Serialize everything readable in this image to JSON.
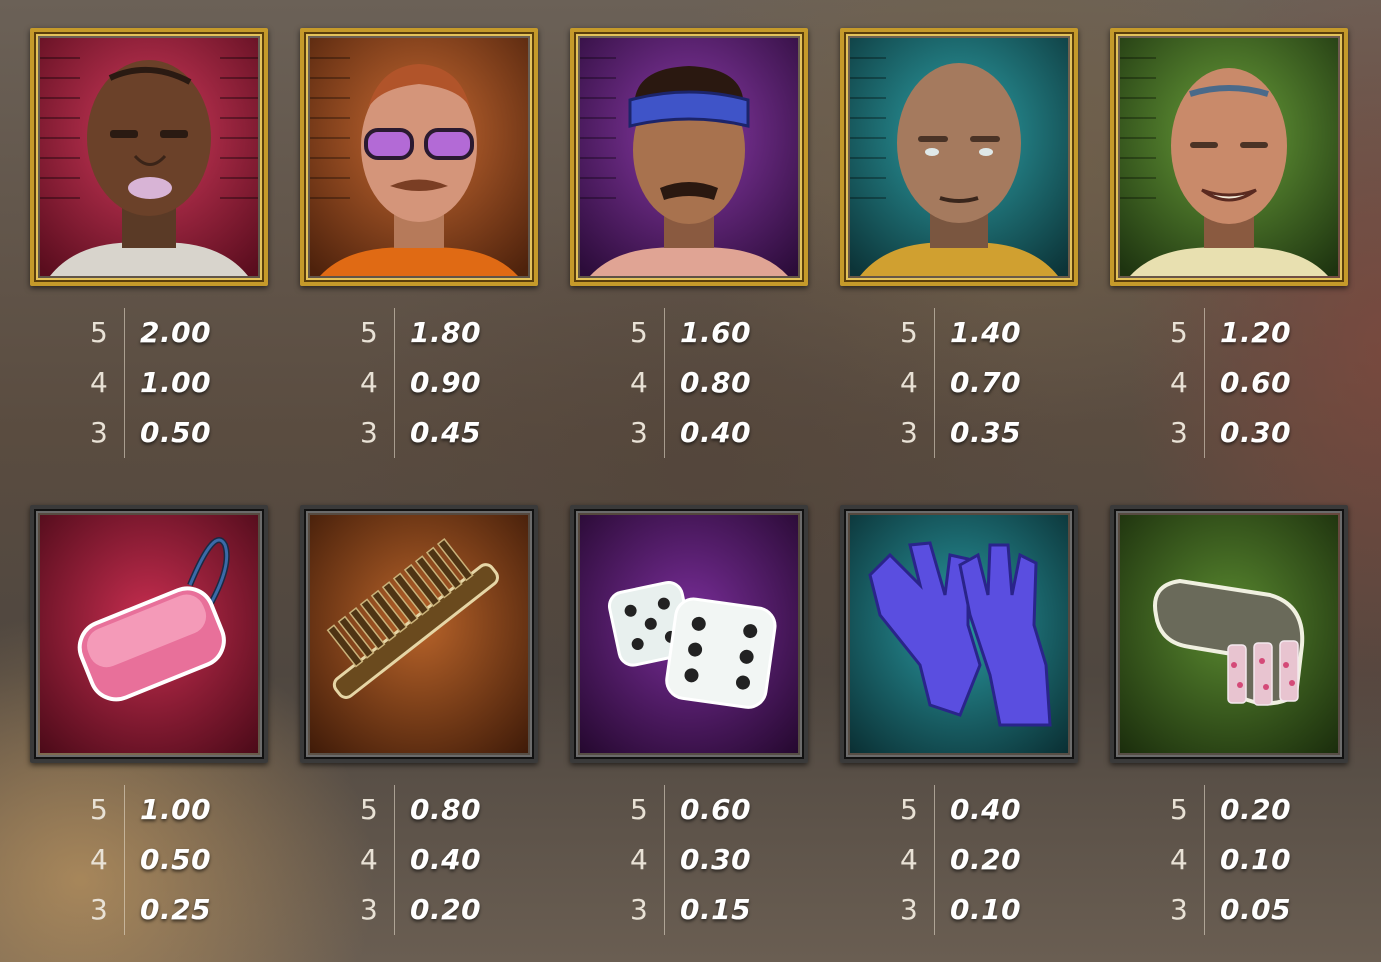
{
  "paytable": {
    "rows": [
      {
        "symbols": [
          {
            "icon": "prisoner-gang-tattoo-icon",
            "frame": "gold",
            "bg": "#b4203f",
            "payouts": [
              {
                "count": "5",
                "value": "2.00"
              },
              {
                "count": "4",
                "value": "1.00"
              },
              {
                "count": "3",
                "value": "0.50"
              }
            ]
          },
          {
            "icon": "prisoner-sunglasses-icon",
            "frame": "gold",
            "bg": "#b4551f",
            "payouts": [
              {
                "count": "5",
                "value": "1.80"
              },
              {
                "count": "4",
                "value": "0.90"
              },
              {
                "count": "3",
                "value": "0.45"
              }
            ]
          },
          {
            "icon": "prisoner-bandana-icon",
            "frame": "gold",
            "bg": "#6b2a82",
            "payouts": [
              {
                "count": "5",
                "value": "1.60"
              },
              {
                "count": "4",
                "value": "0.80"
              },
              {
                "count": "3",
                "value": "0.40"
              }
            ]
          },
          {
            "icon": "prisoner-bald-icon",
            "frame": "gold",
            "bg": "#1f7f86",
            "payouts": [
              {
                "count": "5",
                "value": "1.40"
              },
              {
                "count": "4",
                "value": "0.70"
              },
              {
                "count": "3",
                "value": "0.35"
              }
            ]
          },
          {
            "icon": "prisoner-lucky7-icon",
            "frame": "gold",
            "bg": "#4f7a25",
            "payouts": [
              {
                "count": "5",
                "value": "1.20"
              },
              {
                "count": "4",
                "value": "0.60"
              },
              {
                "count": "3",
                "value": "0.30"
              }
            ]
          }
        ]
      },
      {
        "symbols": [
          {
            "icon": "soap-icon",
            "frame": "steel",
            "bg": "#b4203f",
            "payouts": [
              {
                "count": "5",
                "value": "1.00"
              },
              {
                "count": "4",
                "value": "0.50"
              },
              {
                "count": "3",
                "value": "0.25"
              }
            ]
          },
          {
            "icon": "comb-icon",
            "frame": "steel",
            "bg": "#a8551e",
            "payouts": [
              {
                "count": "5",
                "value": "0.80"
              },
              {
                "count": "4",
                "value": "0.40"
              },
              {
                "count": "3",
                "value": "0.20"
              }
            ]
          },
          {
            "icon": "dice-icon",
            "frame": "steel",
            "bg": "#6b2a82",
            "payouts": [
              {
                "count": "5",
                "value": "0.60"
              },
              {
                "count": "4",
                "value": "0.30"
              },
              {
                "count": "3",
                "value": "0.15"
              }
            ]
          },
          {
            "icon": "gloves-icon",
            "frame": "steel",
            "bg": "#1f7f86",
            "payouts": [
              {
                "count": "5",
                "value": "0.40"
              },
              {
                "count": "4",
                "value": "0.20"
              },
              {
                "count": "3",
                "value": "0.10"
              }
            ]
          },
          {
            "icon": "sock-icon",
            "frame": "steel",
            "bg": "#4f7a25",
            "payouts": [
              {
                "count": "5",
                "value": "0.20"
              },
              {
                "count": "4",
                "value": "0.10"
              },
              {
                "count": "3",
                "value": "0.05"
              }
            ]
          }
        ]
      }
    ]
  }
}
